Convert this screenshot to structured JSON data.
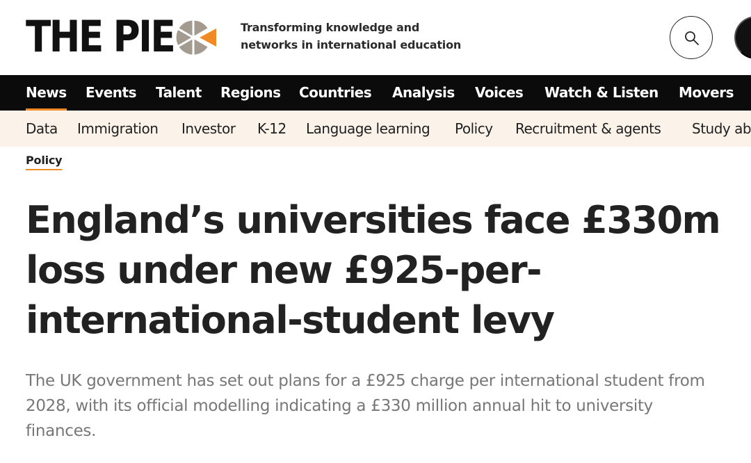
{
  "header": {
    "logo_text": "THE PIE",
    "tagline": "Transforming knowledge and\nnetworks in international education",
    "search_icon": "search-icon",
    "menu_icon": "menu-icon"
  },
  "primary_nav": {
    "items": [
      {
        "label": "News",
        "active": true
      },
      {
        "label": "Events"
      },
      {
        "label": "Talent"
      },
      {
        "label": "Regions"
      },
      {
        "label": "Countries"
      },
      {
        "label": "Analysis"
      },
      {
        "label": "Voices"
      },
      {
        "label": "Watch & Listen"
      },
      {
        "label": "Movers"
      }
    ]
  },
  "secondary_nav": {
    "items": [
      {
        "label": "Data"
      },
      {
        "label": "Immigration"
      },
      {
        "label": "Investor"
      },
      {
        "label": "K-12"
      },
      {
        "label": "Language learning"
      },
      {
        "label": "Policy"
      },
      {
        "label": "Recruitment & agents"
      },
      {
        "label": "Study abroad"
      }
    ]
  },
  "article": {
    "category": "Policy",
    "headline": "England’s universities face £330m loss under new £925-per-international-student levy",
    "standfirst": "The UK government has set out plans for a £925 charge per international student from 2028, with its official modelling indicating a £330 million annual hit to university finances."
  },
  "colors": {
    "accent": "#f08a24",
    "nav_bg": "#0b0b0b",
    "subnav_bg": "#fbf3ea",
    "logo_grey": "#a39a90"
  }
}
